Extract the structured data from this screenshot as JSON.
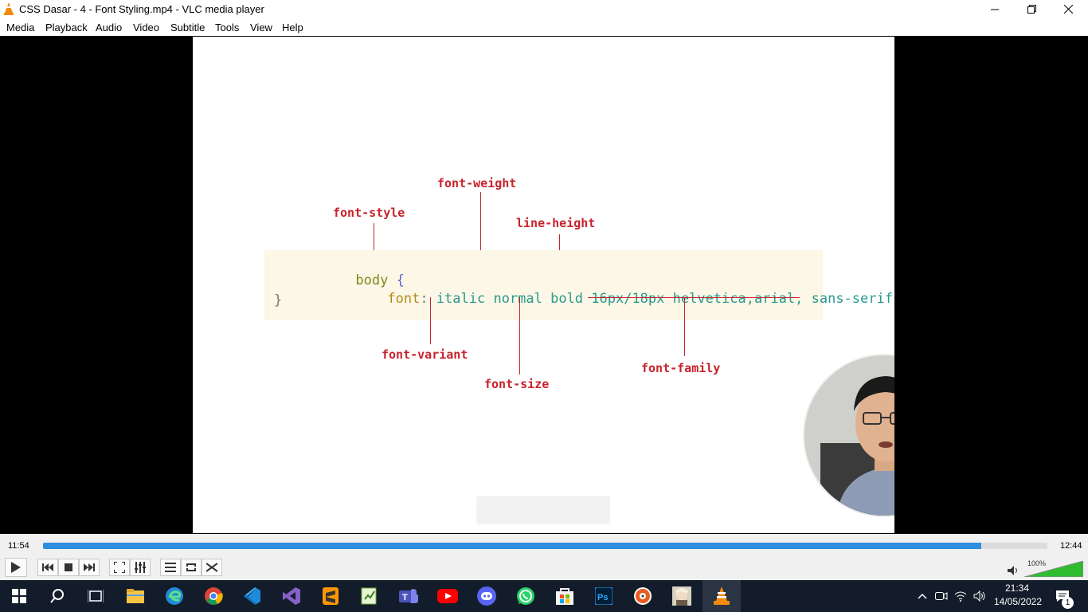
{
  "window": {
    "title": "CSS Dasar - 4 - Font Styling.mp4 - VLC media player"
  },
  "menu": [
    "Media",
    "Playback",
    "Audio",
    "Video",
    "Subtitle",
    "Tools",
    "View",
    "Help"
  ],
  "slide": {
    "labels": {
      "font_weight": "font-weight",
      "font_style": "font-style",
      "line_height": "line-height",
      "font_variant": "font-variant",
      "font_size": "font-size",
      "font_family": "font-family"
    },
    "code": {
      "line1_selector": "body",
      "line1_brace": "{",
      "line2_property": "font",
      "line2_colon": ":",
      "line2_value": "italic normal bold 16px/18px helvetica,arial, sans-serif",
      "line2_semicolon": ";",
      "line3_brace": "}"
    }
  },
  "playback": {
    "elapsed": "11:54",
    "total": "12:44",
    "progress": 0.934
  },
  "volume": {
    "label": "100%",
    "level": 1.0
  },
  "taskbar": {
    "apps": [
      "start",
      "search",
      "task-view",
      "file-explorer",
      "edge",
      "chrome",
      "vscode",
      "visual-studio",
      "sublime-text",
      "notepad-plus",
      "teams",
      "youtube",
      "discord",
      "whatsapp",
      "microsoft-store",
      "photoshop",
      "media-player",
      "game",
      "vlc"
    ],
    "clock_time": "21:34",
    "clock_date": "14/05/2022",
    "notification_count": "1"
  },
  "colors": {
    "accent": "#2e8fe0",
    "slide_label": "#c8232c",
    "taskbar": "#131c2a"
  }
}
